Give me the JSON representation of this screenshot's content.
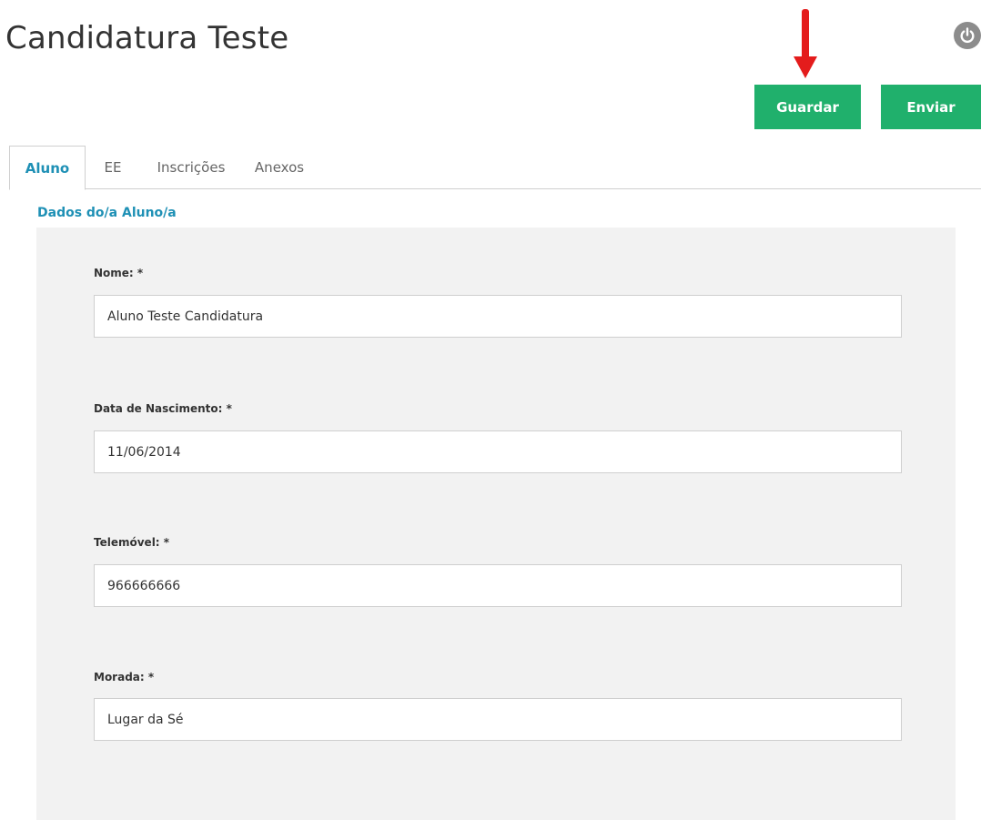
{
  "header": {
    "title": "Candidatura Teste",
    "power_icon": "power-icon"
  },
  "annotation": {
    "icon": "red-arrow-down-icon",
    "color": "#e41c1c"
  },
  "actions": {
    "guardar_label": "Guardar",
    "enviar_label": "Enviar",
    "button_color": "#20b06c"
  },
  "tabs": [
    {
      "label": "Aluno",
      "active": true
    },
    {
      "label": "EE",
      "active": false
    },
    {
      "label": "Inscrições",
      "active": false
    },
    {
      "label": "Anexos",
      "active": false
    }
  ],
  "accent_color": "#1e90b5",
  "section": {
    "title": "Dados do/a Aluno/a"
  },
  "form": {
    "fields": [
      {
        "label": "Nome: *",
        "value": "Aluno Teste Candidatura"
      },
      {
        "label": "Data de Nascimento: *",
        "value": "11/06/2014"
      },
      {
        "label": "Telemóvel: *",
        "value": "966666666"
      },
      {
        "label": "Morada: *",
        "value": "Lugar da Sé"
      }
    ]
  }
}
